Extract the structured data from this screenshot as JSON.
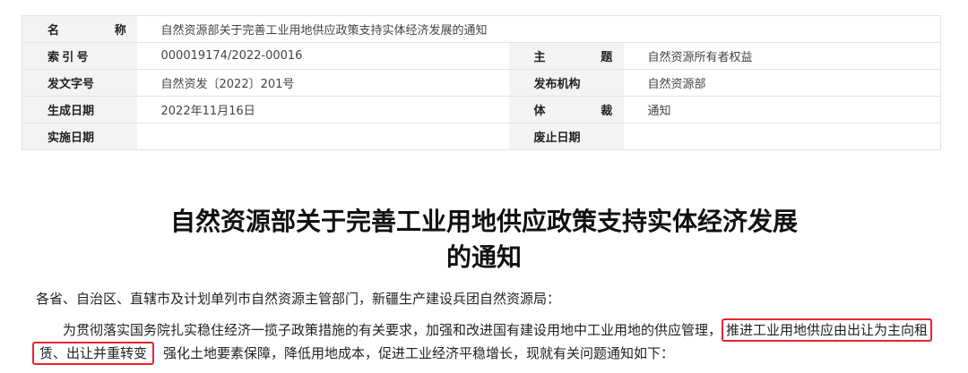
{
  "meta_table": {
    "rows": [
      {
        "label1": "名  称",
        "value1": "自然资源部关于完善工业用地供应政策支持实体经济发展的通知"
      },
      {
        "label1": "索引号",
        "value1": "000019174/2022-00016",
        "label2": "主  题",
        "value2": "自然资源所有者权益"
      },
      {
        "label1": "发文字号",
        "value1": "自然资发〔2022〕201号",
        "label2": "发布机构",
        "value2": "自然资源部"
      },
      {
        "label1": "生成日期",
        "value1": "2022年11月16日",
        "label2": "体  裁",
        "value2": "通知"
      },
      {
        "label1": "实施日期",
        "value1": "",
        "label2": "废止日期",
        "value2": ""
      }
    ]
  },
  "document": {
    "title_line1": "自然资源部关于完善工业用地供应政策支持实体经济发展",
    "title_line2": "的通知",
    "salutation": "各省、自治区、直辖市及计划单列市自然资源主管部门，新疆生产建设兵团自然资源局：",
    "para1_part1": "为贯彻落实国务院扎实稳住经济一揽子政策措施的有关要求，加强和改进国有建设用地中工业用地的供应管理，",
    "para1_highlight1": "推进工业用地供应由出让为主向租",
    "para1_highlight2": "赁、出让并重转变",
    "para1_part2": "强化土地要素保障，降低用地成本，促进工业经济平稳增长，现就有关问题通知如下："
  },
  "highlight_color": "#e8232d"
}
